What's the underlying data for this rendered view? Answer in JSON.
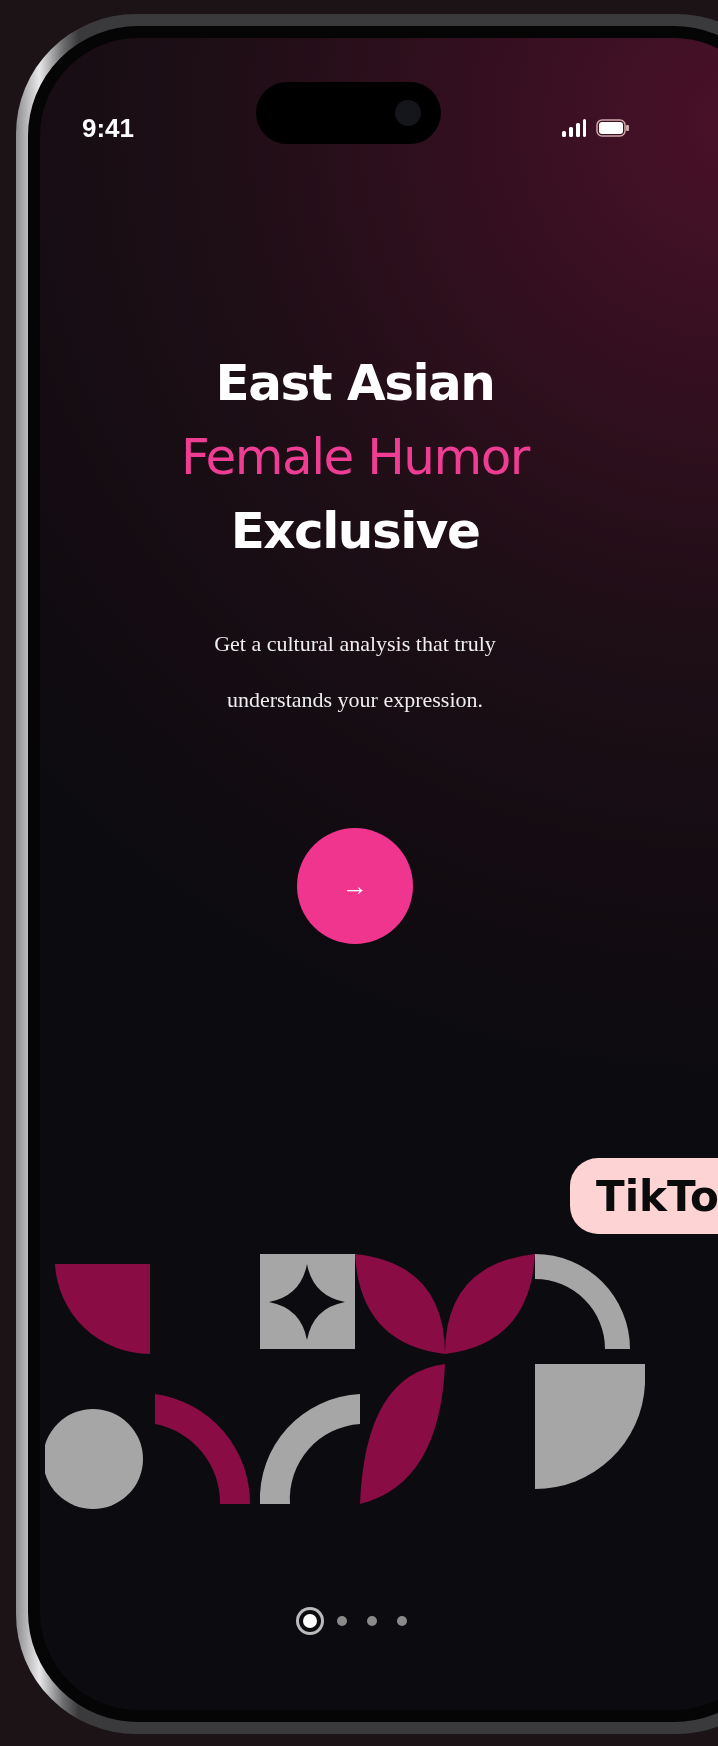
{
  "status_bar": {
    "time": "9:41"
  },
  "headline": [
    {
      "text": "East Asian",
      "accent": false
    },
    {
      "text": "Female Humor",
      "accent": true
    },
    {
      "text": "Exclusive",
      "accent": false
    }
  ],
  "subtitle": "Get a cultural analysis that truly understands your expression.",
  "next_button": {
    "icon": "→"
  },
  "badge": {
    "text": "TikTo"
  },
  "pager": [
    {
      "selected": true
    },
    {
      "selected": false
    },
    {
      "selected": false
    },
    {
      "selected": false
    }
  ]
}
